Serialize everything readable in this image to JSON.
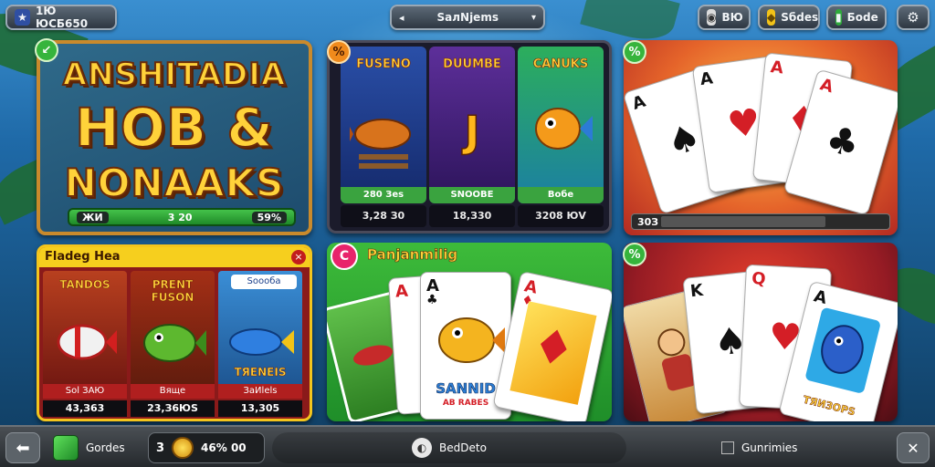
{
  "topbar": {
    "player_text": "1Ю ЮСБ650",
    "search_text": "SалNjems",
    "pill1_text": "ВЮ",
    "pill2_text": "Sбdes",
    "pill3_text": "Боdе"
  },
  "tile_logo": {
    "badge": "↙",
    "line1": "ANSHITADIA",
    "line2": "HOB &",
    "line3": "NONAAKS",
    "bar_left": "ЖИ",
    "bar_mid": "3 20",
    "bar_right": "59%"
  },
  "tile_slots": {
    "badge": "%",
    "slots": [
      {
        "title": "FUSENO",
        "foot": "280 Зes",
        "value": "3,28 З0"
      },
      {
        "title": "DUUMBE",
        "foot": "SNOOBE",
        "value": "18,З30"
      },
      {
        "title": "CANUKS",
        "foot": "Вобе",
        "value": "3208 ЮV"
      }
    ]
  },
  "tile_cards1": {
    "badge": "%",
    "progress_label": "30З"
  },
  "tile_fish": {
    "header": "Fladeg Неа",
    "close": "×",
    "games": [
      {
        "title": "TANDOS",
        "label": "Sol ЗАЮ",
        "value": "43,З63"
      },
      {
        "title": "PRENT FUSON",
        "label": "Вяще",
        "value": "23,З6ЮS"
      },
      {
        "title": "ТЯЕNEIS",
        "label": "ЗаИlels",
        "value": "13,305"
      }
    ],
    "tag": "Sоооба"
  },
  "tile_green": {
    "title": "Panjanmilig",
    "badge": "C",
    "fish_text": "SANNID",
    "fish_sub": "АВ RАВЕS"
  },
  "tile_cards2": {
    "badge": "%",
    "card_text": "ТЯИЗОРS"
  },
  "bottom": {
    "cards_label": "Gordes",
    "coins_count": "3",
    "coins_value": "46% 00",
    "center_label": "ВеdDеtо",
    "right_label": "Gunrimies"
  }
}
